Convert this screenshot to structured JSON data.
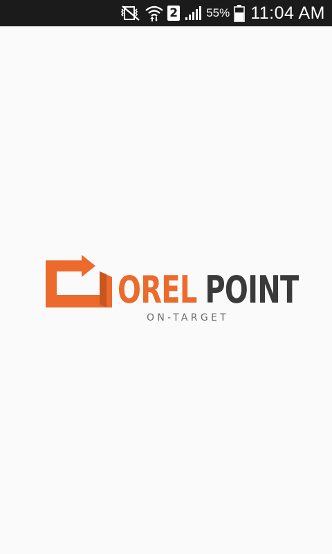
{
  "status_bar": {
    "icons": [
      "silent-vibrate-icon",
      "wifi-icon",
      "sim-2-icon",
      "signal-icon",
      "battery-icon"
    ],
    "sim_slot": "2",
    "battery_percent": "55%",
    "time": "11:04 AM",
    "background_color": "#1b1b1b"
  },
  "splash": {
    "logo_icon": "refresh-arrow-logo-icon",
    "brand_word_1": "OREL",
    "brand_word_2": "POINT",
    "tagline": "ON-TARGET",
    "brand_orange": "#ec6a2b",
    "brand_dark": "#3a3a3a",
    "background_color": "#fafafa"
  }
}
